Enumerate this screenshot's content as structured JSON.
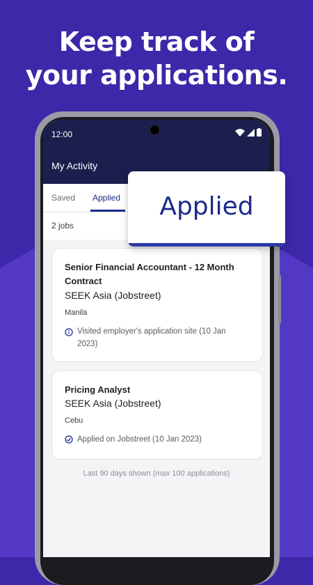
{
  "colors": {
    "background": "#3c28a8",
    "background_lower": "#5238c4",
    "appbar": "#1a1f4e",
    "accent": "#1c2a8a"
  },
  "headline": {
    "line1": "Keep track of",
    "line2": "your applications."
  },
  "status_bar": {
    "time": "12:00"
  },
  "appbar": {
    "title": "My Activity"
  },
  "tabs": [
    {
      "label": "Saved",
      "active": false
    },
    {
      "label": "Applied",
      "active": true
    }
  ],
  "job_count": "2 jobs",
  "jobs": [
    {
      "title": "Senior Financial Accountant - 12 Month Contract",
      "company": "SEEK Asia (Jobstreet)",
      "location": "Manila",
      "status_icon": "info-icon",
      "status": "Visited employer's application site (10 Jan 2023)"
    },
    {
      "title": "Pricing Analyst",
      "company": "SEEK Asia (Jobstreet)",
      "location": "Cebu",
      "status_icon": "check-circle-icon",
      "status": "Applied on Jobstreet (10 Jan 2023)"
    }
  ],
  "footer_note": "Last 90 days shown (max 100 applications)",
  "popup": {
    "label": "Applied"
  }
}
